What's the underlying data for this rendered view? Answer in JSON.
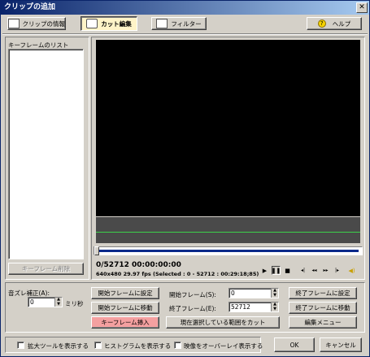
{
  "window": {
    "title": "クリップの追加",
    "close_glyph": "✕"
  },
  "toolbar": {
    "clip_info": "クリップの情報",
    "cut_edit": "カット編集",
    "filter": "フィルター",
    "help": "ヘルプ",
    "help_glyph": "?"
  },
  "keyframes": {
    "list_label": "キーフレームのリスト",
    "delete_button": "キーフレーム削除"
  },
  "status": {
    "frame_time": "0/52712  00:00:00:00",
    "info": "640x480 29.97 fps  (Selected : 0 - 52712 : 00:29:18;85)"
  },
  "transport": {
    "play": "▶",
    "pause": "❚❚",
    "stop": "■",
    "prev_key": "◂|",
    "rewind": "◂◂",
    "forward": "▸▸",
    "next_key": "|▸",
    "volume_glyph": "◀)"
  },
  "audio": {
    "offset_label": "音ズレ補正(A):",
    "offset_value": "0",
    "unit": "ミリ秒"
  },
  "edit": {
    "set_start": "開始フレームに設定",
    "goto_start": "開始フレームに移動",
    "insert_keyframe": "キーフレーム挿入",
    "start_frame_label": "開始フレーム(S):",
    "start_frame_value": "0",
    "end_frame_label": "終了フレーム(E):",
    "end_frame_value": "52712",
    "cut_selection": "現在選択している範囲をカット",
    "set_end": "終了フレームに設定",
    "goto_end": "終了フレームに移動",
    "edit_menu": "編集メニュー"
  },
  "options": {
    "zoom_tool": "拡大ツールを表示する",
    "histogram": "ヒストグラムを表示する",
    "overlay": "映像をオーバーレイ表示する"
  },
  "footer": {
    "ok": "OK",
    "cancel": "キャンセル"
  },
  "colors": {
    "title_start": "#0a246a",
    "title_end": "#a6caf0",
    "active_tab": "#fff4c8",
    "insert_button": "#f4a0a0",
    "timeline_line": "#3cd24a",
    "slider_fill": "#0a2a8a"
  },
  "progress": {
    "slider_position": 0.0
  }
}
